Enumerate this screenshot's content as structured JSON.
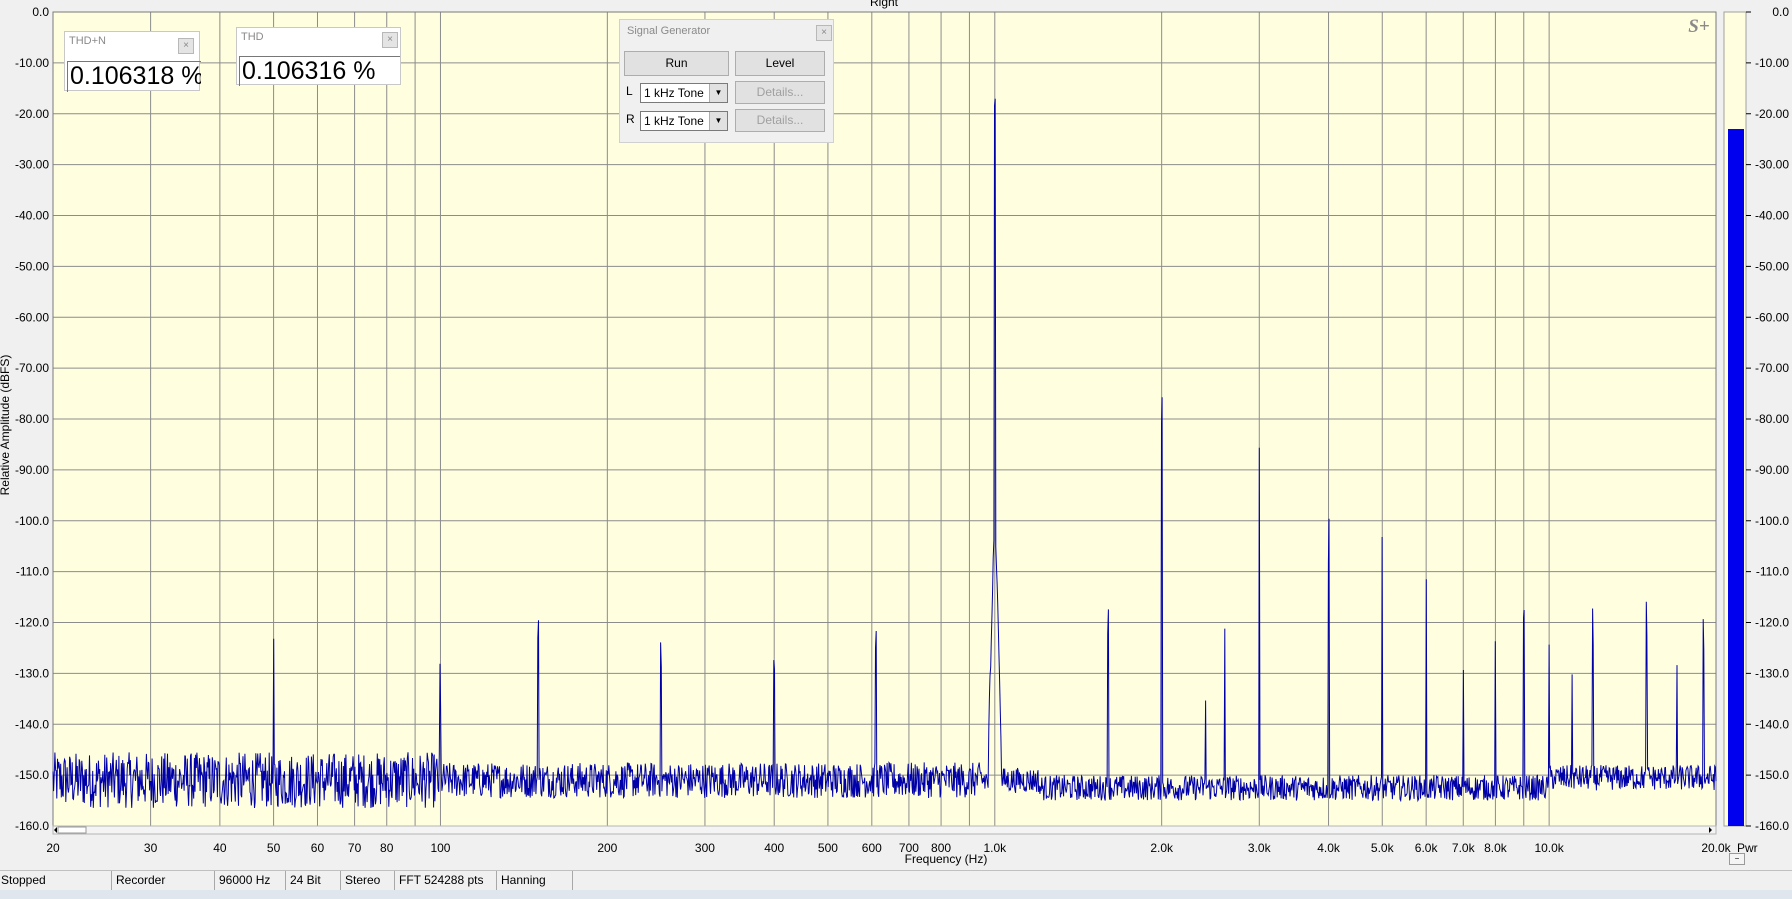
{
  "window": {
    "plot_title": "Right"
  },
  "chart_data": {
    "type": "line",
    "title": "Right",
    "xlabel": "Frequency (Hz)",
    "ylabel": "Relative Amplitude (dBFS)",
    "x_scale": "log",
    "xlim": [
      20,
      20000
    ],
    "ylim": [
      -160,
      0
    ],
    "grid": true,
    "x_ticks": [
      20,
      30,
      40,
      50,
      60,
      70,
      80,
      100,
      200,
      300,
      400,
      500,
      600,
      700,
      800,
      1000,
      2000,
      3000,
      4000,
      5000,
      6000,
      7000,
      8000,
      10000,
      20000
    ],
    "x_tick_labels": [
      "20",
      "30",
      "40",
      "50",
      "60",
      "70",
      "80",
      "100",
      "200",
      "300",
      "400",
      "500",
      "600",
      "700",
      "800",
      "1.0k",
      "2.0k",
      "3.0k",
      "4.0k",
      "5.0k",
      "6.0k",
      "7.0k",
      "8.0k",
      "10.0k",
      "20.0k"
    ],
    "y_ticks": [
      0,
      -10,
      -20,
      -30,
      -40,
      -50,
      -60,
      -70,
      -80,
      -90,
      -100,
      -110,
      -120,
      -130,
      -140,
      -150,
      -160
    ],
    "y_tick_labels": [
      "0.0",
      "-10.00",
      "-20.00",
      "-30.00",
      "-40.00",
      "-50.00",
      "-60.00",
      "-70.00",
      "-80.00",
      "-90.00",
      "-100.0",
      "-110.0",
      "-120.0",
      "-130.0",
      "-140.0",
      "-150.0",
      "-160.0"
    ],
    "noise_floor_db": -150,
    "series": [
      {
        "color": "#0000a8",
        "peaks": [
          {
            "x": 50,
            "y": -125
          },
          {
            "x": 100,
            "y": -140
          },
          {
            "x": 150,
            "y": -129
          },
          {
            "x": 250,
            "y": -134
          },
          {
            "x": 400,
            "y": -136
          },
          {
            "x": 610,
            "y": -131
          },
          {
            "x": 1000,
            "y": -23.5
          },
          {
            "x": 1600,
            "y": -127.5
          },
          {
            "x": 2000,
            "y": -86
          },
          {
            "x": 2400,
            "y": -136
          },
          {
            "x": 2600,
            "y": -122.5
          },
          {
            "x": 3000,
            "y": -86.5
          },
          {
            "x": 4000,
            "y": -111.5
          },
          {
            "x": 5000,
            "y": -106.5
          },
          {
            "x": 6000,
            "y": -114
          },
          {
            "x": 7000,
            "y": -131.5
          },
          {
            "x": 8000,
            "y": -125.5
          },
          {
            "x": 9000,
            "y": -126
          },
          {
            "x": 10000,
            "y": -126
          },
          {
            "x": 11000,
            "y": -130.5
          },
          {
            "x": 12000,
            "y": -128.5
          },
          {
            "x": 15000,
            "y": -127
          },
          {
            "x": 17000,
            "y": -131
          },
          {
            "x": 19000,
            "y": -130
          }
        ]
      }
    ]
  },
  "meter": {
    "label": "Pwr",
    "level_db": -23,
    "bar_color": "#0000ee",
    "tick_labels": [
      "0.0",
      "-10.00",
      "-20.00",
      "-30.00",
      "-40.00",
      "-50.00",
      "-60.00",
      "-70.00",
      "-80.00",
      "-90.00",
      "-100.0",
      "-110.0",
      "-120.0",
      "-130.0",
      "-140.0",
      "-150.0",
      "-160.0"
    ]
  },
  "panels": {
    "thdn": {
      "title": "THD+N",
      "value": "0.106318 %",
      "close": "×"
    },
    "thd": {
      "title": "THD",
      "value": "0.106316 %",
      "close": "×"
    }
  },
  "signal_generator": {
    "title": "Signal Generator",
    "close": "×",
    "run_label": "Run",
    "level_label": "Level",
    "left_label": "L",
    "right_label": "R",
    "left_select": "1 kHz Tone",
    "right_select": "1 kHz Tone",
    "details_label": "Details..."
  },
  "logo": "S+",
  "status": {
    "state": "Stopped",
    "mode": "Recorder",
    "rate": "96000 Hz",
    "bits": "24 Bit",
    "channels": "Stereo",
    "fft": "FFT 524288 pts",
    "window": "Hanning"
  },
  "colors": {
    "plot_bg": "#ffffe0",
    "grid": "#8c8c8c",
    "trace": "#0000a8"
  }
}
